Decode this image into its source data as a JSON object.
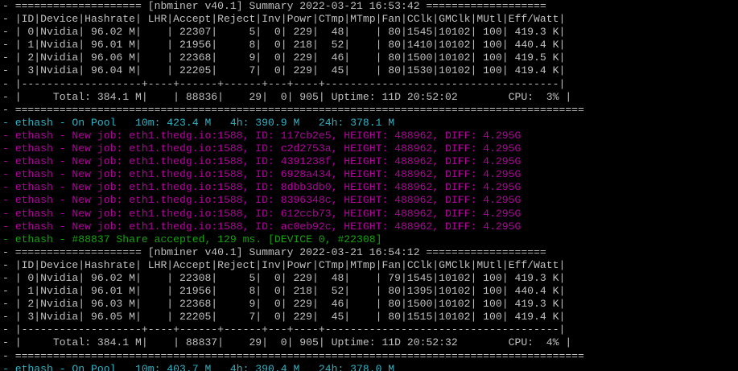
{
  "colors": {
    "background": "#000000",
    "white": "#c0c0c0",
    "cyan": "#2fb3c4",
    "magenta": "#b4009e",
    "green": "#13a10e"
  },
  "lines": [
    {
      "text": "- ==================== [nbminer v40.1] Summary 2022-03-21 16:53:42 ===================",
      "color": "white"
    },
    {
      "text": "- |ID|Device|Hashrate| LHR|Accept|Reject|Inv|Powr|CTmp|MTmp|Fan|CClk|GMClk|MUtl|Eff/Watt|",
      "color": "white"
    },
    {
      "text": "- | 0|Nvidia| 96.02 M|    | 22307|     5|  0| 229|  48|    | 80|1545|10102| 100| 419.3 K|",
      "color": "white"
    },
    {
      "text": "- | 1|Nvidia| 96.01 M|    | 21956|     8|  0| 218|  52|    | 80|1410|10102| 100| 440.4 K|",
      "color": "white"
    },
    {
      "text": "- | 2|Nvidia| 96.06 M|    | 22368|     9|  0| 229|  46|    | 80|1500|10102| 100| 419.5 K|",
      "color": "white"
    },
    {
      "text": "- | 3|Nvidia| 96.04 M|    | 22205|     7|  0| 229|  45|    | 80|1530|10102| 100| 419.4 K|",
      "color": "white"
    },
    {
      "text": "- |-------------------+----+------+------+---+----+-------------------------------------|",
      "color": "white"
    },
    {
      "text": "- |     Total: 384.1 M|    | 88836|    29|  0| 905| Uptime: 11D 20:52:02        CPU:  3% |",
      "color": "white"
    },
    {
      "text": "- ==========================================================================================",
      "color": "white"
    },
    {
      "text": "- ethash - On Pool   10m: 423.4 M   4h: 390.9 M   24h: 378.1 M",
      "color": "cyan"
    },
    {
      "text": "- ethash - New job: eth1.thedg.io:1588, ID: 117cb2e5, HEIGHT: 488962, DIFF: 4.295G",
      "color": "magenta"
    },
    {
      "text": "- ethash - New job: eth1.thedg.io:1588, ID: c2d2753a, HEIGHT: 488962, DIFF: 4.295G",
      "color": "magenta"
    },
    {
      "text": "- ethash - New job: eth1.thedg.io:1588, ID: 4391238f, HEIGHT: 488962, DIFF: 4.295G",
      "color": "magenta"
    },
    {
      "text": "- ethash - New job: eth1.thedg.io:1588, ID: 6928a434, HEIGHT: 488962, DIFF: 4.295G",
      "color": "magenta"
    },
    {
      "text": "- ethash - New job: eth1.thedg.io:1588, ID: 8dbb3db0, HEIGHT: 488962, DIFF: 4.295G",
      "color": "magenta"
    },
    {
      "text": "- ethash - New job: eth1.thedg.io:1588, ID: 8396348c, HEIGHT: 488962, DIFF: 4.295G",
      "color": "magenta"
    },
    {
      "text": "- ethash - New job: eth1.thedg.io:1588, ID: 612ccb73, HEIGHT: 488962, DIFF: 4.295G",
      "color": "magenta"
    },
    {
      "text": "- ethash - New job: eth1.thedg.io:1588, ID: ac0eb92c, HEIGHT: 488962, DIFF: 4.295G",
      "color": "magenta"
    },
    {
      "text": "- ethash - #88837 Share accepted, 129 ms. [DEVICE 0, #22308]",
      "color": "green"
    },
    {
      "text": "- ==================== [nbminer v40.1] Summary 2022-03-21 16:54:12 ===================",
      "color": "white"
    },
    {
      "text": "- |ID|Device|Hashrate| LHR|Accept|Reject|Inv|Powr|CTmp|MTmp|Fan|CClk|GMClk|MUtl|Eff/Watt|",
      "color": "white"
    },
    {
      "text": "- | 0|Nvidia| 96.02 M|    | 22308|     5|  0| 229|  48|    | 79|1545|10102| 100| 419.3 K|",
      "color": "white"
    },
    {
      "text": "- | 1|Nvidia| 96.01 M|    | 21956|     8|  0| 218|  52|    | 80|1395|10102| 100| 440.4 K|",
      "color": "white"
    },
    {
      "text": "- | 2|Nvidia| 96.03 M|    | 22368|     9|  0| 229|  46|    | 80|1500|10102| 100| 419.3 K|",
      "color": "white"
    },
    {
      "text": "- | 3|Nvidia| 96.05 M|    | 22205|     7|  0| 229|  45|    | 80|1515|10102| 100| 419.4 K|",
      "color": "white"
    },
    {
      "text": "- |-------------------+----+------+------+---+----+-------------------------------------|",
      "color": "white"
    },
    {
      "text": "- |     Total: 384.1 M|    | 88837|    29|  0| 905| Uptime: 11D 20:52:32        CPU:  4% |",
      "color": "white"
    },
    {
      "text": "- ==========================================================================================",
      "color": "white"
    },
    {
      "text": "- ethash - On Pool   10m: 403.7 M   4h: 390.4 M   24h: 378.0 M",
      "color": "cyan"
    }
  ]
}
